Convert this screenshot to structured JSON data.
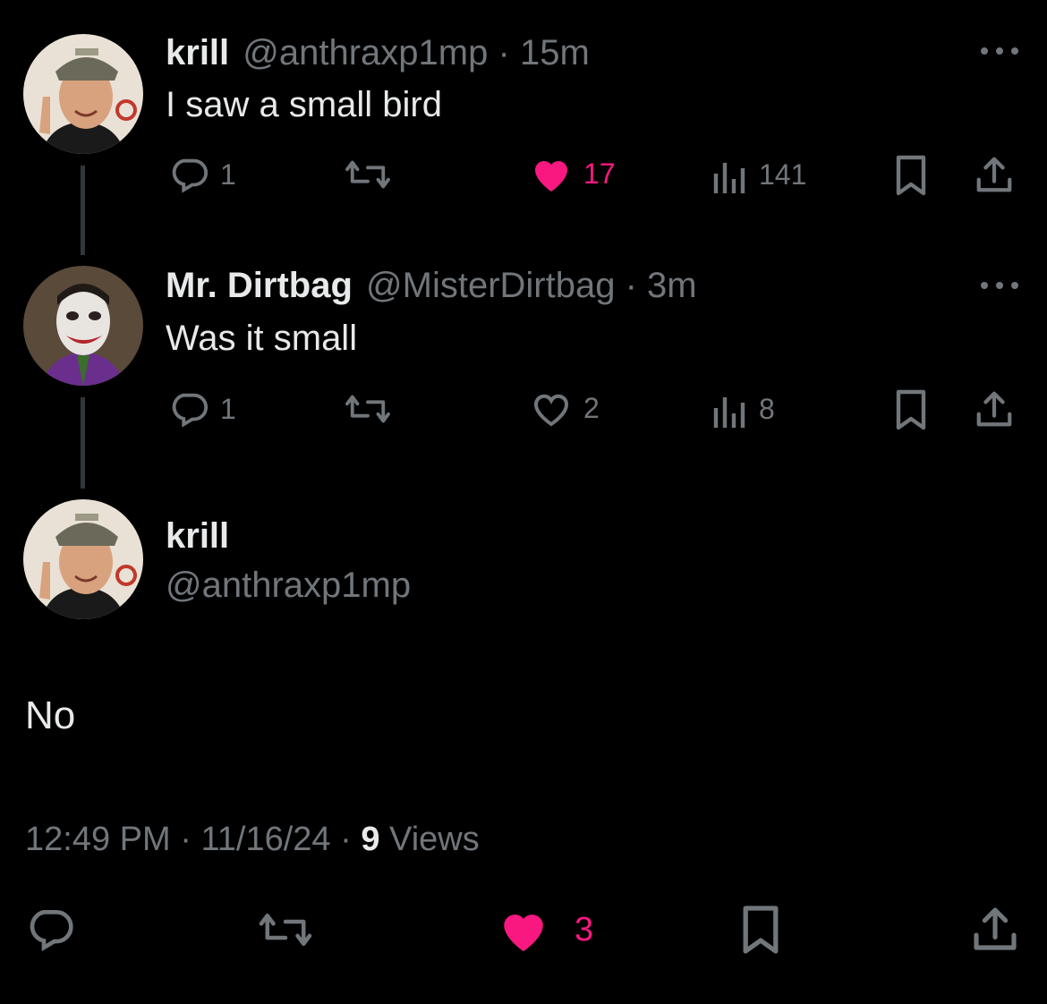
{
  "colors": {
    "background": "#000000",
    "text": "#e7e9ea",
    "muted": "#71767b",
    "like": "#f91880",
    "thread_line": "#333639"
  },
  "tweet1": {
    "name": "krill",
    "handle": "@anthraxp1mp",
    "sep": "·",
    "time": "15m",
    "text": "I saw a small bird",
    "replies": "1",
    "likes": "17",
    "views": "141",
    "liked": true
  },
  "tweet2": {
    "name": "Mr. Dirtbag",
    "handle": "@MisterDirtbag",
    "sep": "·",
    "time": "3m",
    "text": "Was it small",
    "replies": "1",
    "likes": "2",
    "views": "8",
    "liked": false
  },
  "main": {
    "name": "krill",
    "handle": "@anthraxp1mp",
    "text": "No",
    "time": "12:49 PM",
    "sep1": "·",
    "date": "11/16/24",
    "sep2": "·",
    "views_count": "9",
    "views_label": "Views",
    "likes": "3",
    "liked": true
  },
  "icons": [
    "more-icon",
    "reply-icon",
    "retweet-icon",
    "heart-icon",
    "views-icon",
    "bookmark-icon",
    "share-icon"
  ]
}
